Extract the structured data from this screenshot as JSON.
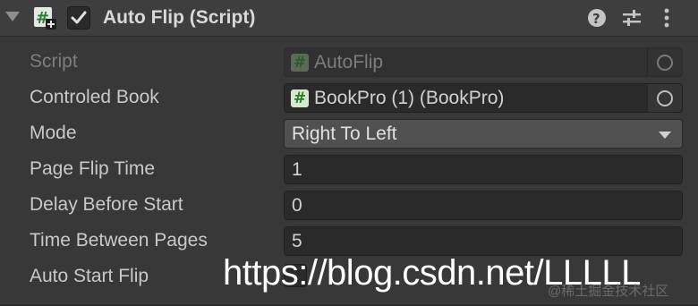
{
  "component": {
    "title": "Auto Flip (Script)",
    "enabled": true,
    "icons": [
      "script-add-icon",
      "help-icon",
      "presets-icon",
      "more-options-icon"
    ]
  },
  "fields": {
    "script": {
      "label": "Script",
      "value": "AutoFlip"
    },
    "controled_book": {
      "label": "Controled Book",
      "value": "BookPro (1) (BookPro)"
    },
    "mode": {
      "label": "Mode",
      "value": "Right To Left"
    },
    "page_flip_time": {
      "label": "Page Flip Time",
      "value": "1"
    },
    "delay_before_start": {
      "label": "Delay Before Start",
      "value": "0"
    },
    "time_between_pages": {
      "label": "Time Between Pages",
      "value": "5"
    },
    "auto_start_flip": {
      "label": "Auto Start Flip",
      "checked": false
    }
  },
  "overlay": {
    "watermark_url": "https://blog.csdn.net/LLLLL",
    "watermark_small": "@稀土掘金技术社区"
  },
  "colors": {
    "background": "#383838",
    "field": "#2a2a2a",
    "dropdown": "#505050",
    "script_icon_green": "#2c7d2c"
  }
}
